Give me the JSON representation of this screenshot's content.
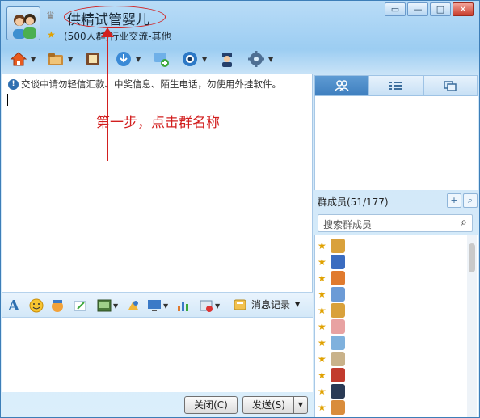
{
  "header": {
    "group_name": "供精试管婴儿",
    "group_info": "(500人群)行业交流-其他"
  },
  "window_controls": {
    "restore": "▭",
    "minimize": "—",
    "maximize": "□",
    "close": "✕"
  },
  "toolbar": {
    "items": [
      "home-icon",
      "folder-icon",
      "album-icon",
      "share-icon",
      "chat-add-icon",
      "camera-icon",
      "admin-icon",
      "gear-icon"
    ]
  },
  "chat": {
    "notice": "交谈中请勿轻信汇款、中奖信息、陌生电话，勿使用外挂软件。",
    "annotation": "第一步，点击群名称"
  },
  "format_bar": {
    "message_history": "消息记录"
  },
  "buttons": {
    "close": "关闭(C)",
    "send": "发送(S)"
  },
  "members": {
    "header": "群成员(51/177)",
    "search_placeholder": "搜索群成员",
    "list_colors": [
      "#d9a13b",
      "#3a6cc0",
      "#e07a2e",
      "#6c9bd6",
      "#d9a13b",
      "#e8a2a2",
      "#7fb1dd",
      "#c9b28a",
      "#c23b2e",
      "#2a3a55",
      "#d98c3b"
    ]
  },
  "colors": {
    "accent": "#3d7eb8",
    "annotation": "#d21f1f",
    "star": "#e0a100"
  }
}
